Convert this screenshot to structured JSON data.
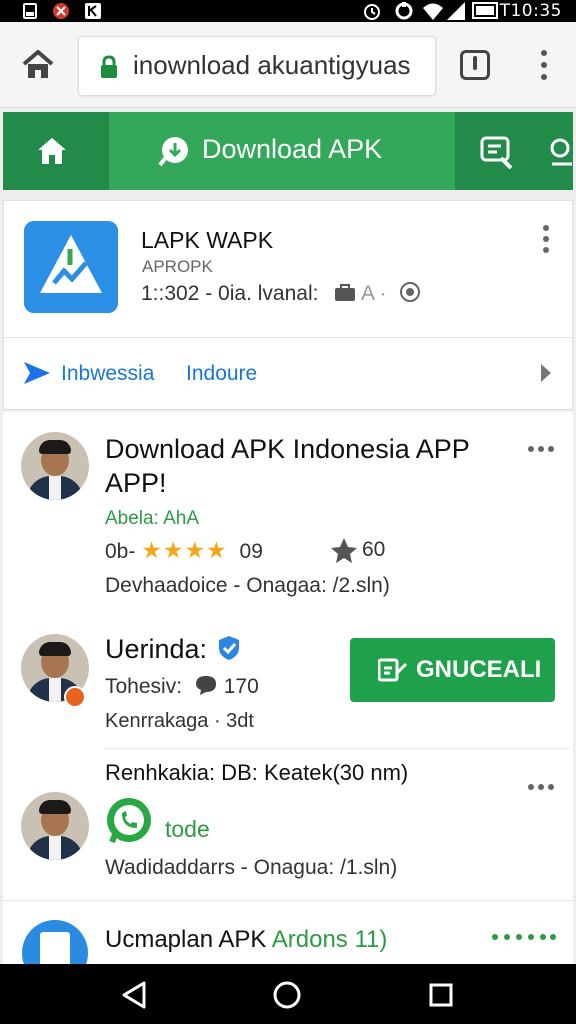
{
  "status_bar": {
    "time": "T10:35",
    "left_icons": [
      "notification-icon",
      "missed-call-icon",
      "app-notification-icon"
    ],
    "right_icons": [
      "alarm-icon",
      "sync-icon",
      "wifi-icon",
      "signal-icon",
      "battery-icon"
    ]
  },
  "browser": {
    "url": "inownload akuantigyuas"
  },
  "green_nav": {
    "active_label": "Download APK",
    "accent": "#228b49",
    "active_color": "#34a85a"
  },
  "app_card": {
    "title": "LAPK WAPK",
    "subtitle": "APROPK",
    "meta": "1::302 - 0ia. lvanal:",
    "meta_suffix": "A ·",
    "lang_1": "Inbwessia",
    "lang_2": "Indoure"
  },
  "list": {
    "items": [
      {
        "title_line1": "Download  APK Indonesia APP",
        "title_line2": "APP!",
        "subtitle": "Abela: AhA",
        "rating_left": "0b-",
        "stars": "★★★★",
        "rating_value": "09",
        "rating_right": "60",
        "footer": "Devhaadoice - Onagaa: /2.sln)"
      },
      {
        "title": "Uerinda:",
        "line2": "Tohesiv:",
        "count": "170",
        "line3": "Kenrrakaga · 3dt",
        "button_label": "GNUCEALI"
      },
      {
        "title": "Renhkakia: DB: Keatek(30 nm)",
        "whatsapp_label": "tode",
        "footer": "Wadidaddarrs - Onagua: /1.sln)"
      },
      {
        "title": "Ucmaplan APK",
        "title_green": "Ardons 11)"
      }
    ]
  }
}
